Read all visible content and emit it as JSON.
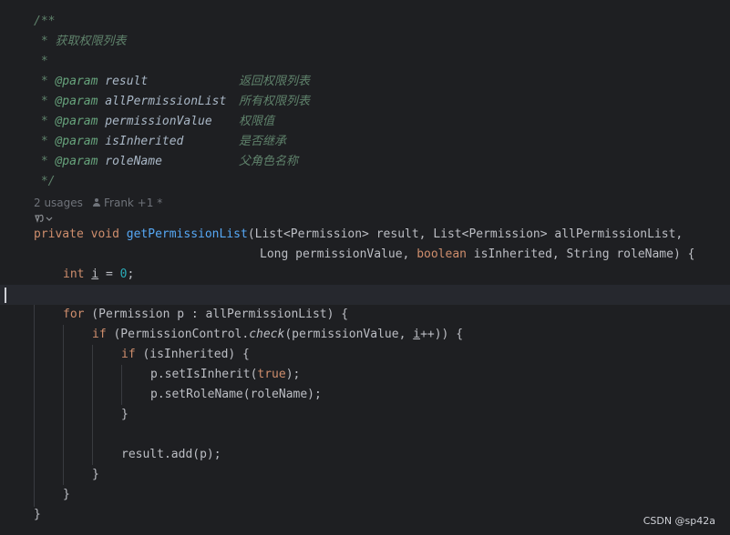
{
  "javadoc": {
    "open": "/**",
    "star": " *",
    "description": "获取权限列表",
    "close": " */",
    "tag": "@param",
    "params": [
      {
        "name": "result",
        "desc": "返回权限列表"
      },
      {
        "name": "allPermissionList",
        "desc": "所有权限列表"
      },
      {
        "name": "permissionValue",
        "desc": "权限值"
      },
      {
        "name": "isInherited",
        "desc": "是否继承"
      },
      {
        "name": "roleName",
        "desc": "父角色名称"
      }
    ]
  },
  "inlay": {
    "usages": "2 usages",
    "author": "Frank +1 *"
  },
  "icons": {
    "author": "person-icon",
    "ai_assistant": "ai-assistant-icon"
  },
  "code": {
    "kw_private": "private",
    "kw_void": "void",
    "method_name": "getPermissionList",
    "sig1_rest": "(List<Permission> result, List<Permission> allPermissionList,",
    "sig2_long": "Long permissionValue, ",
    "kw_boolean": "boolean",
    "sig2_rest": " isInherited, String roleName) {",
    "kw_int": "int",
    "var_i": "i",
    "assign": " = ",
    "zero": "0",
    "semi": ";",
    "kw_for": "for",
    "for_rest": " (Permission p : allPermissionList) {",
    "kw_if": "if",
    "if1_a": " (PermissionControl.",
    "if1_check": "check",
    "if1_b": "(permissionValue, ",
    "if1_c": "++)) {",
    "if2_rest": " (isInherited) {",
    "set_inherit_a": "p.setIsInherit(",
    "kw_true": "true",
    "set_inherit_b": ");",
    "set_role": "p.setRoleName(roleName);",
    "close_brace": "}",
    "result_add": "result.add(p);"
  },
  "colors": {
    "background": "#1e1f22",
    "current_line": "#26282e",
    "keyword": "#cf8e6d",
    "function": "#56a8f5",
    "number": "#2aacb8",
    "doc_comment": "#5f826b",
    "plain": "#bcbec4"
  },
  "watermark": "CSDN @sp42a"
}
